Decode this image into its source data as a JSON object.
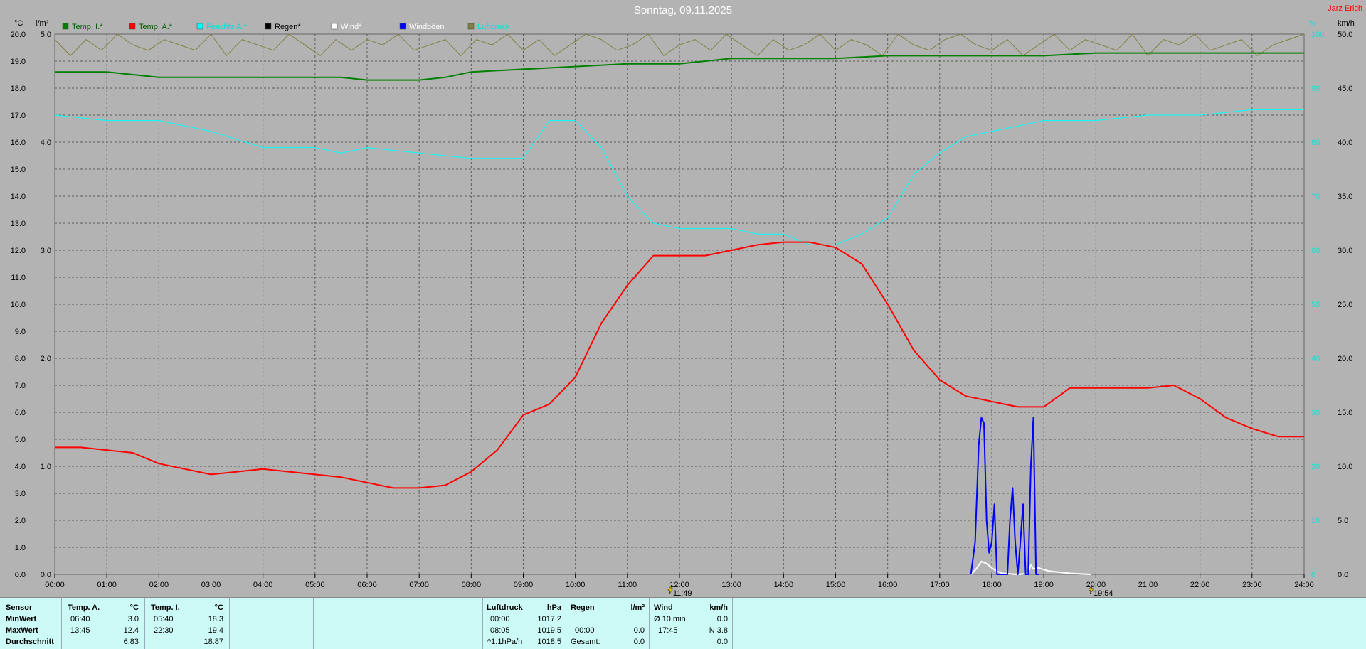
{
  "title": "Sonntag, 09.11.2025",
  "author": "Jarz Erich",
  "unit_labels": {
    "left_temp": "°C",
    "left_rain": "l/m²",
    "right_pct": "%",
    "right_wind": "km/h"
  },
  "legend": [
    {
      "label": "Temp. I.*",
      "color": "#008000",
      "text_color": "#006000"
    },
    {
      "label": "Temp. A.*",
      "color": "#ff0000",
      "text_color": "#006000"
    },
    {
      "label": "Feuchte A.*",
      "color": "#00ffff",
      "text_color": "#00e0e0"
    },
    {
      "label": "Regen*",
      "color": "#000000",
      "text_color": "#000000"
    },
    {
      "label": "Wind*",
      "color": "#ffffff",
      "text_color": "#ffffff"
    },
    {
      "label": "Windböen",
      "color": "#0000ff",
      "text_color": "#ffffff"
    },
    {
      "label": "Luftdruck",
      "color": "#808040",
      "text_color": "#00e0e0"
    }
  ],
  "chart_data": {
    "type": "line",
    "x_ticks": [
      "00:00",
      "01:00",
      "02:00",
      "03:00",
      "04:00",
      "05:00",
      "06:00",
      "07:00",
      "08:00",
      "09:00",
      "10:00",
      "11:00",
      "12:00",
      "13:00",
      "14:00",
      "15:00",
      "16:00",
      "17:00",
      "18:00",
      "19:00",
      "20:00",
      "21:00",
      "22:00",
      "23:00",
      "24:00"
    ],
    "y_left_temp_ticks": [
      "0.0",
      "1.0",
      "2.0",
      "3.0",
      "4.0",
      "5.0",
      "6.0",
      "7.0",
      "8.0",
      "9.0",
      "10.0",
      "11.0",
      "12.0",
      "13.0",
      "14.0",
      "15.0",
      "16.0",
      "17.0",
      "18.0",
      "19.0",
      "20.0"
    ],
    "y_left_rain_ticks": [
      "0.0",
      "1.0",
      "2.0",
      "3.0",
      "4.0",
      "5.0"
    ],
    "y_right_pct_ticks": [
      "0",
      "10",
      "20",
      "30",
      "40",
      "50",
      "60",
      "70",
      "80",
      "90",
      "100"
    ],
    "y_right_wind_ticks": [
      "0.0",
      "5.0",
      "10.0",
      "15.0",
      "20.0",
      "25.0",
      "30.0",
      "35.0",
      "40.0",
      "45.0",
      "50.0"
    ],
    "xlim": [
      0,
      24
    ],
    "ylim_temp": [
      0,
      20
    ],
    "ylim_rain": [
      0,
      5
    ],
    "ylim_pct": [
      0,
      100
    ],
    "ylim_wind": [
      0,
      50
    ],
    "grid": true,
    "markers": [
      {
        "x": 11.82,
        "label": "11:49"
      },
      {
        "x": 19.9,
        "label": "19:54"
      }
    ],
    "series": [
      {
        "name": "Temp. I.*",
        "axis": "temp",
        "color": "#008000",
        "x": [
          0,
          1,
          1.5,
          2,
          3,
          4,
          5,
          5.5,
          6,
          7,
          7.5,
          8,
          9,
          10,
          11,
          12,
          13,
          14,
          15,
          16,
          17,
          18,
          19,
          20,
          21,
          22,
          23,
          24
        ],
        "y": [
          18.6,
          18.6,
          18.5,
          18.4,
          18.4,
          18.4,
          18.4,
          18.4,
          18.3,
          18.3,
          18.4,
          18.6,
          18.7,
          18.8,
          18.9,
          18.9,
          19.1,
          19.1,
          19.1,
          19.2,
          19.2,
          19.2,
          19.2,
          19.3,
          19.3,
          19.3,
          19.3,
          19.3
        ]
      },
      {
        "name": "Temp. A.*",
        "axis": "temp",
        "color": "#ff0000",
        "x": [
          0,
          0.5,
          1,
          1.5,
          2,
          2.5,
          3,
          3.5,
          4,
          4.5,
          5,
          5.5,
          6,
          6.5,
          7,
          7.5,
          8,
          8.5,
          9,
          9.5,
          10,
          10.5,
          11,
          11.5,
          12,
          12.5,
          13,
          13.5,
          14,
          14.5,
          15,
          15.5,
          16,
          16.5,
          17,
          17.5,
          18,
          18.5,
          19,
          19.5,
          20,
          20.5,
          21,
          21.5,
          22,
          22.5,
          23,
          23.5,
          24
        ],
        "y": [
          4.7,
          4.7,
          4.6,
          4.5,
          4.1,
          3.9,
          3.7,
          3.8,
          3.9,
          3.8,
          3.7,
          3.6,
          3.4,
          3.2,
          3.2,
          3.3,
          3.8,
          4.6,
          5.9,
          6.3,
          7.3,
          9.3,
          10.7,
          11.8,
          11.8,
          11.8,
          12.0,
          12.2,
          12.3,
          12.3,
          12.1,
          11.5,
          10.0,
          8.3,
          7.2,
          6.6,
          6.4,
          6.2,
          6.2,
          6.9,
          6.9,
          6.9,
          6.9,
          7.0,
          6.5,
          5.8,
          5.4,
          5.1,
          5.1
        ]
      },
      {
        "name": "Feuchte A.*",
        "axis": "pct",
        "color": "#00ffff",
        "x": [
          0,
          1,
          2,
          3,
          4,
          5,
          5.5,
          6,
          7,
          8,
          8.5,
          9,
          9.5,
          10,
          10.5,
          11,
          11.5,
          12,
          12.5,
          13,
          13.5,
          14,
          14.5,
          15,
          15.5,
          16,
          16.5,
          17,
          17.5,
          18,
          18.5,
          19,
          20,
          21,
          22,
          23,
          24
        ],
        "y": [
          85,
          84,
          84,
          82,
          79,
          79,
          78,
          79,
          78,
          77,
          77,
          77,
          84,
          84,
          79,
          70,
          65,
          64,
          64,
          64,
          63,
          63,
          61,
          61,
          63,
          66,
          74,
          78,
          81,
          82,
          83,
          84,
          84,
          85,
          85,
          86,
          86
        ]
      },
      {
        "name": "Windböen",
        "axis": "wind",
        "color": "#0000ff",
        "x": [
          17.6,
          17.68,
          17.75,
          17.8,
          17.85,
          17.9,
          17.95,
          18.0,
          18.05,
          18.1,
          18.2,
          18.3,
          18.35,
          18.4,
          18.45,
          18.5,
          18.55,
          18.6,
          18.65,
          18.7,
          18.75,
          18.8,
          18.85,
          18.9
        ],
        "y": [
          0,
          3,
          12,
          14.5,
          14,
          5,
          2,
          3,
          6.5,
          0,
          0,
          0,
          5,
          8,
          3,
          0,
          3,
          6.5,
          0,
          0,
          10,
          14.5,
          0,
          0
        ]
      },
      {
        "name": "Wind*",
        "axis": "wind",
        "color": "#ffffff",
        "x": [
          17.6,
          17.7,
          17.8,
          17.9,
          18.0,
          18.1,
          18.2,
          18.5,
          18.7,
          18.75,
          18.8,
          18.9,
          19.1,
          19.5,
          19.9
        ],
        "y": [
          0,
          0.5,
          1.2,
          1.0,
          0.6,
          0.3,
          0.1,
          0,
          0.1,
          0.9,
          0.5,
          0.6,
          0.3,
          0.1,
          0
        ]
      },
      {
        "name": "Luftdruck",
        "axis": "pct",
        "color": "#808040",
        "x": [
          0,
          0.3,
          0.6,
          0.9,
          1.2,
          1.5,
          1.8,
          2.1,
          2.4,
          2.7,
          3.0,
          3.3,
          3.6,
          3.9,
          4.2,
          4.5,
          4.8,
          5.1,
          5.4,
          5.7,
          6.0,
          6.3,
          6.6,
          6.9,
          7.2,
          7.5,
          7.8,
          8.1,
          8.4,
          8.7,
          9.0,
          9.3,
          9.6,
          9.9,
          10.2,
          10.5,
          10.8,
          11.1,
          11.4,
          11.7,
          12.0,
          12.3,
          12.6,
          12.9,
          13.2,
          13.5,
          13.8,
          14.1,
          14.4,
          14.7,
          15.0,
          15.3,
          15.6,
          15.9,
          16.2,
          16.5,
          16.8,
          17.1,
          17.4,
          17.7,
          18.0,
          18.3,
          18.6,
          18.9,
          19.2,
          19.5,
          19.8,
          20.1,
          20.4,
          20.7,
          21.0,
          21.3,
          21.6,
          21.9,
          22.2,
          22.5,
          22.8,
          23.1,
          23.4,
          23.7,
          24.0
        ],
        "y": [
          99,
          96,
          99,
          97,
          100,
          98,
          97,
          99,
          98,
          97,
          100,
          96,
          99,
          98,
          97,
          100,
          98,
          96,
          99,
          97,
          99,
          98,
          100,
          97,
          98,
          99,
          96,
          99,
          98,
          100,
          97,
          99,
          96,
          98,
          100,
          99,
          97,
          98,
          100,
          96,
          98,
          99,
          97,
          100,
          98,
          96,
          99,
          97,
          98,
          100,
          97,
          99,
          98,
          96,
          100,
          98,
          97,
          99,
          100,
          98,
          97,
          99,
          96,
          98,
          100,
          97,
          99,
          98,
          97,
          100,
          96,
          99,
          98,
          100,
          97,
          98,
          99,
          96,
          98,
          99,
          100
        ]
      }
    ]
  },
  "summary": {
    "row_labels": [
      "Sensor",
      "MinWert",
      "MaxWert",
      "Durchschnitt"
    ],
    "temp_a": {
      "header": "Temp. A.",
      "unit": "°C",
      "min_time": "06:40",
      "min_val": "3.0",
      "max_time": "13:45",
      "max_val": "12.4",
      "avg": "6.83"
    },
    "temp_i": {
      "header": "Temp. I.",
      "unit": "°C",
      "min_time": "05:40",
      "min_val": "18.3",
      "max_time": "22:30",
      "max_val": "19.4",
      "avg": "18.87"
    },
    "pressure": {
      "header": "Luftdruck",
      "unit": "hPa",
      "r1_label": "00:00",
      "r1_val": "1017.2",
      "r2_label": "08:05",
      "r2_val": "1019.5",
      "r3_label": "^1.1hPa/h",
      "r3_val": "1018.5"
    },
    "rain": {
      "header": "Regen",
      "unit": "l/m²",
      "r1_label": "",
      "r1_val": "",
      "r2_label": "00:00",
      "r2_val": "0.0",
      "r3_label": "Gesamt:",
      "r3_val": "0.0"
    },
    "wind": {
      "header": "Wind",
      "unit": "km/h",
      "r1_label": "Ø 10 min.",
      "r1_val": "0.0",
      "r2_label": "17:45",
      "r2_val": "N 3.8",
      "r3_label": "",
      "r3_val": "0.0"
    }
  }
}
